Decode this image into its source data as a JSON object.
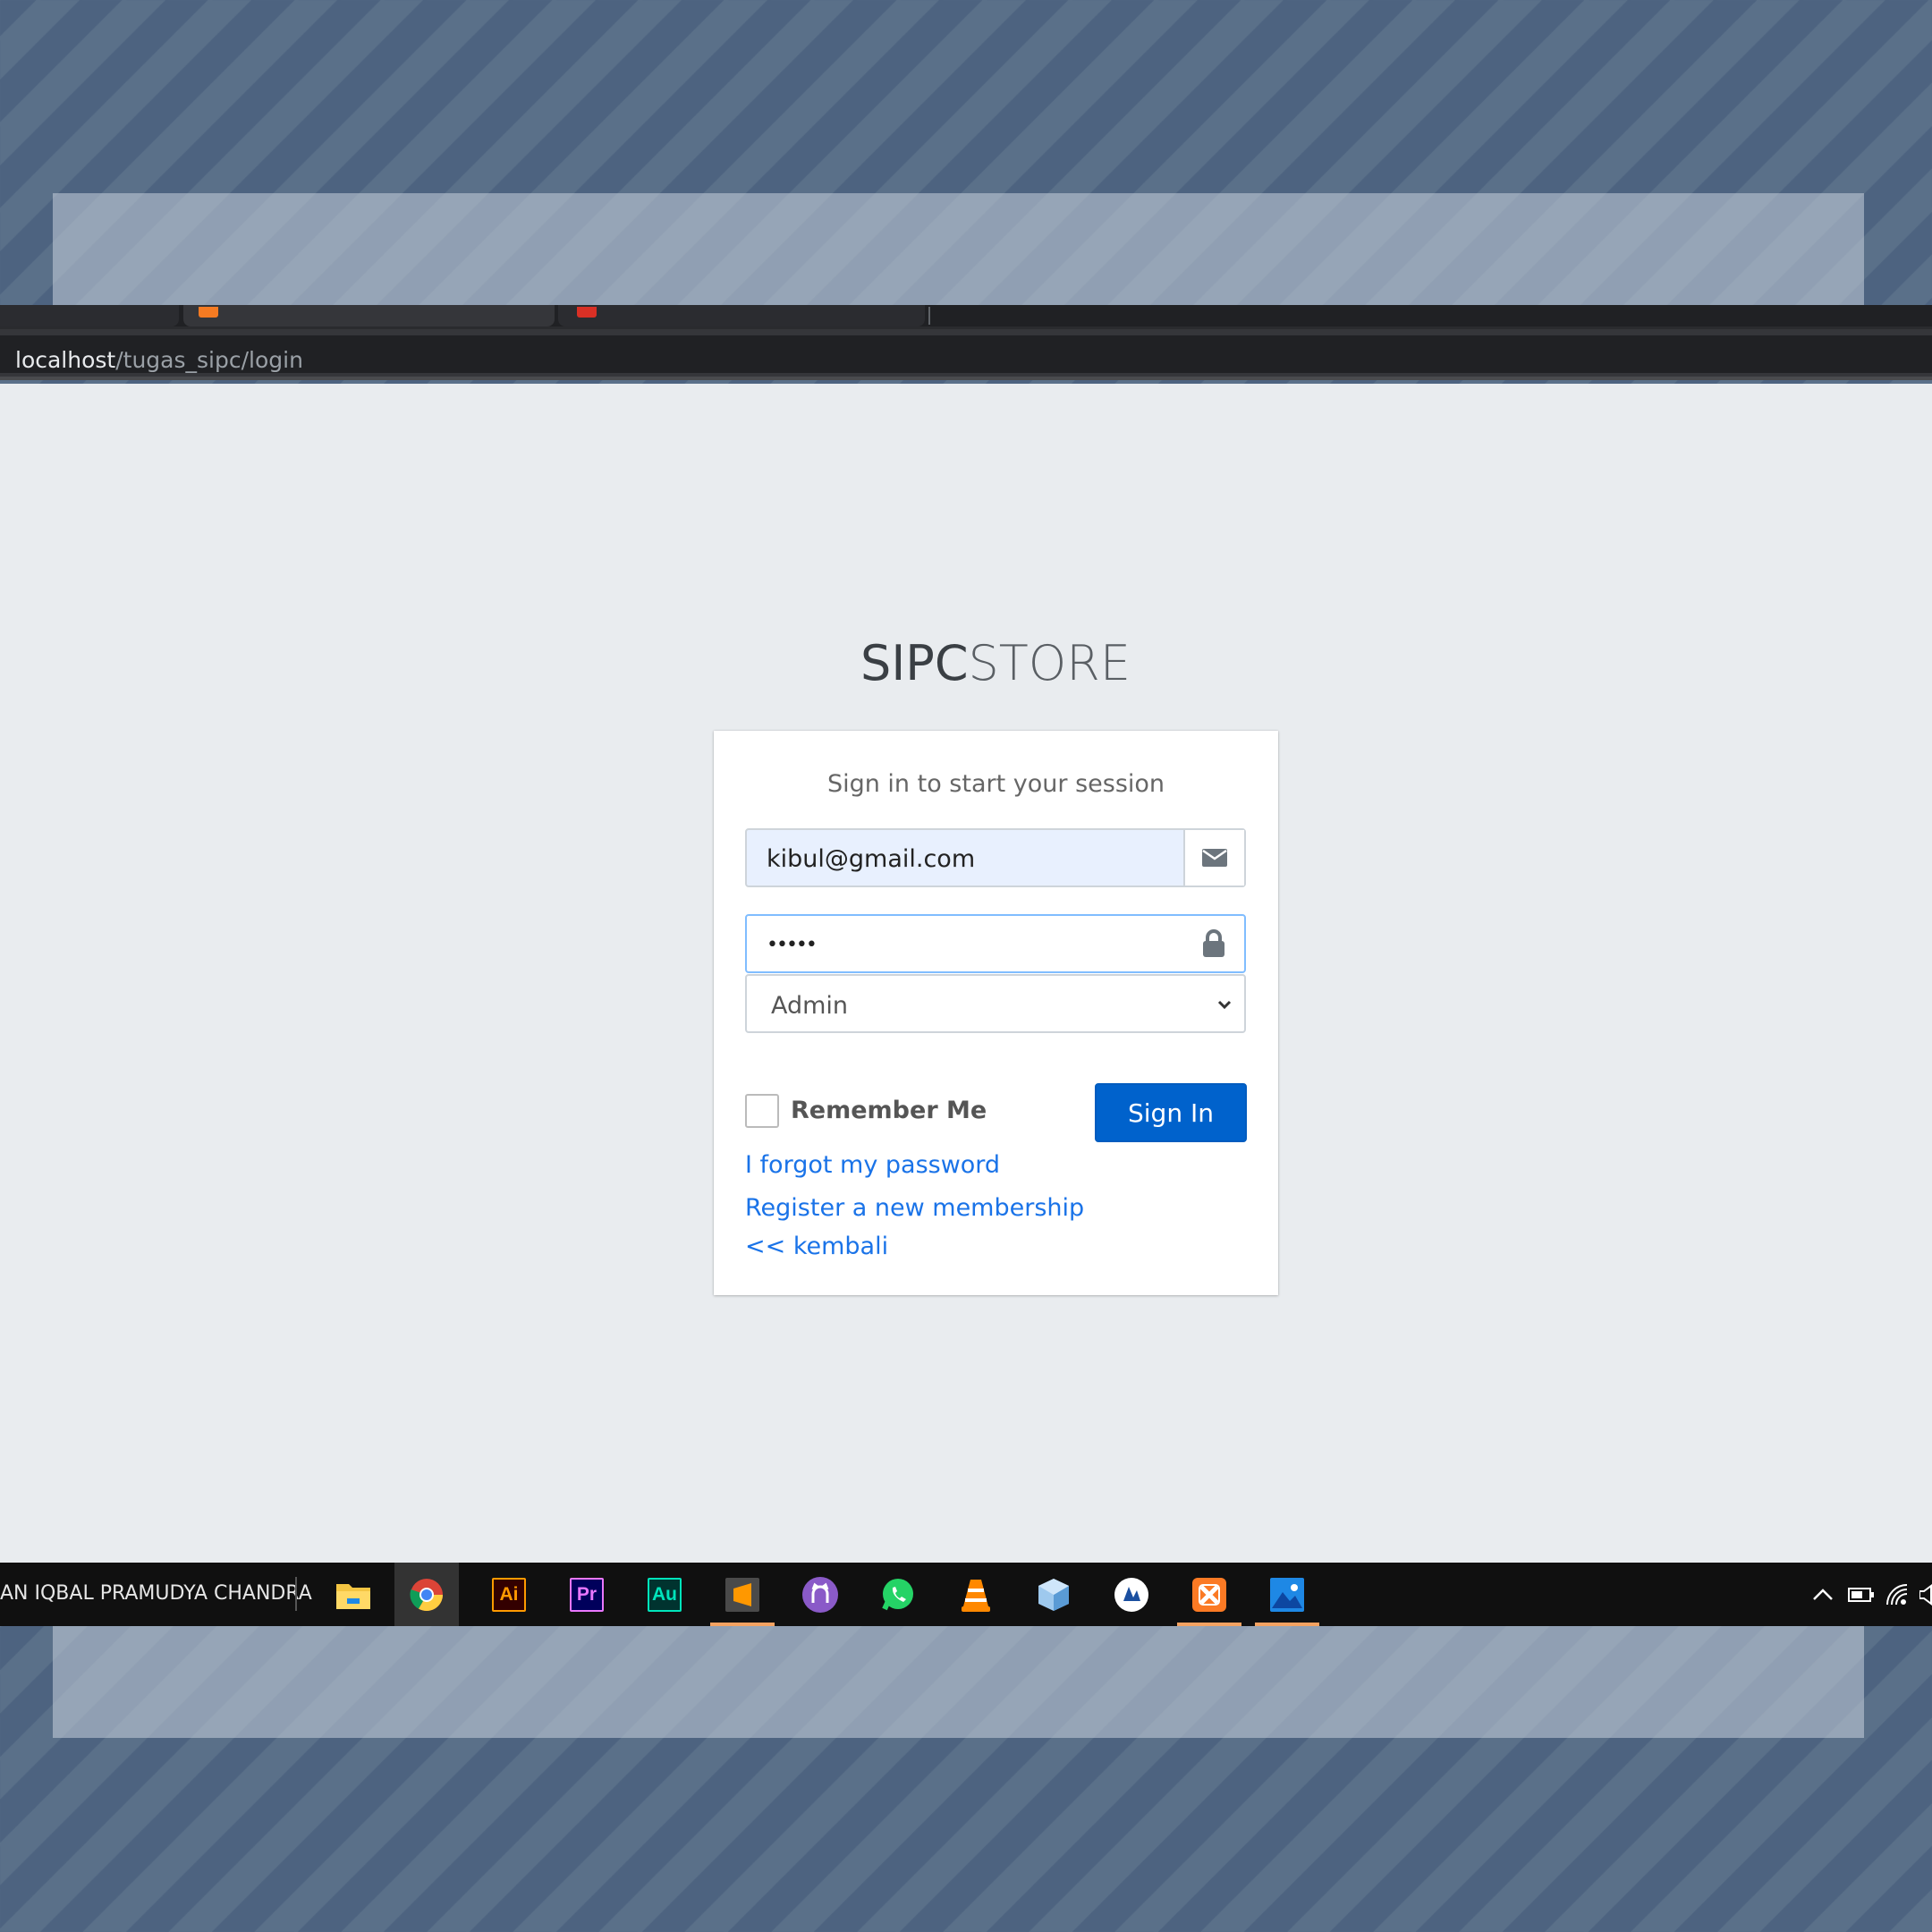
{
  "browser": {
    "address": {
      "host": "localhost",
      "path": "/tugas_sipc/login"
    }
  },
  "page": {
    "brand": {
      "strong": "SIPC",
      "light": "STORE"
    },
    "login_message": "Sign in to start your session",
    "email": {
      "value": "kibul@gmail.com",
      "icon": "envelope-icon"
    },
    "password": {
      "value": "•••••",
      "icon": "lock-icon"
    },
    "role_select": {
      "selected": "Admin"
    },
    "remember_me": {
      "label": "Remember Me",
      "checked": false
    },
    "sign_in_label": "Sign In",
    "links": {
      "forgot": "I forgot my password",
      "register": "Register a new membership",
      "back": "<< kembali"
    },
    "colors": {
      "primary": "#0062cc",
      "link": "#1a73e8",
      "page_bg": "#e9ecef"
    }
  },
  "taskbar": {
    "user_name": "AN IQBAL PRAMUDYA CHANDRA",
    "apps": [
      {
        "name": "file-explorer",
        "label": ""
      },
      {
        "name": "chrome",
        "label": ""
      },
      {
        "name": "illustrator",
        "label": "Ai"
      },
      {
        "name": "premiere",
        "label": "Pr"
      },
      {
        "name": "audition",
        "label": "Au"
      },
      {
        "name": "sublime-text",
        "label": ""
      },
      {
        "name": "github-desktop",
        "label": ""
      },
      {
        "name": "whatsapp",
        "label": ""
      },
      {
        "name": "vlc",
        "label": ""
      },
      {
        "name": "virtualbox",
        "label": ""
      },
      {
        "name": "app-circle",
        "label": ""
      },
      {
        "name": "xampp",
        "label": ""
      },
      {
        "name": "photos",
        "label": ""
      }
    ]
  }
}
